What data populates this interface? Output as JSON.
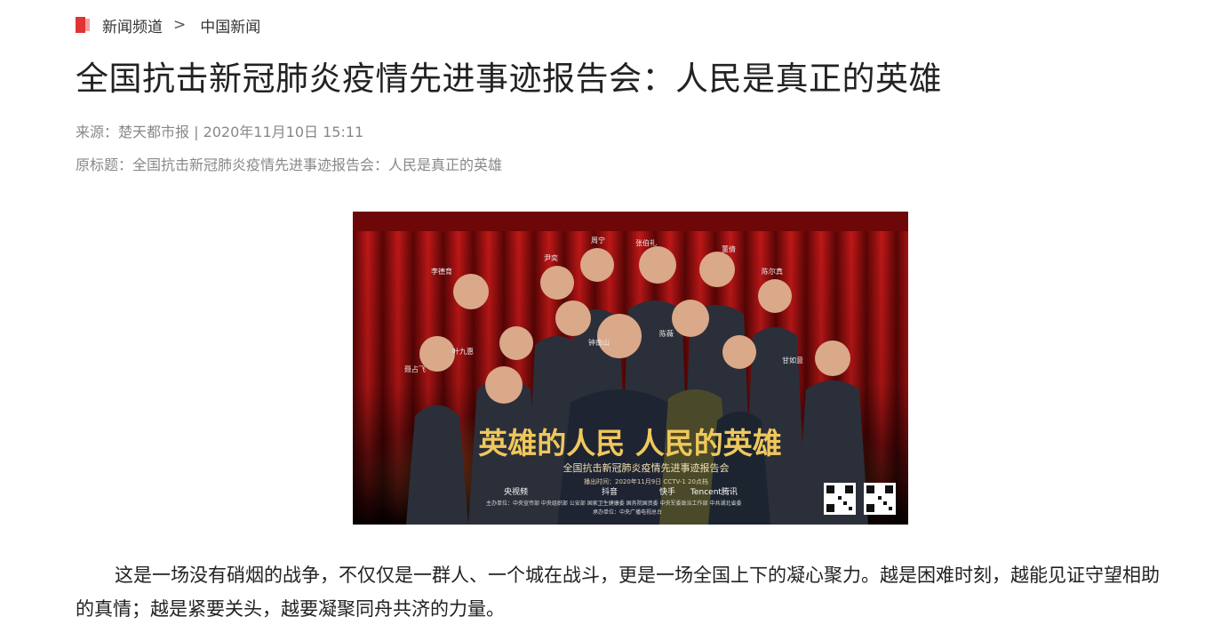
{
  "breadcrumb": {
    "channel": "新闻频道",
    "separator": ">",
    "section": "中国新闻"
  },
  "article": {
    "title": "全国抗击新冠肺炎疫情先进事迹报告会：人民是真正的英雄",
    "meta": "来源：楚天都市报 | 2020年11月10日 15:11",
    "original_title": "原标题：全国抗击新冠肺炎疫情先进事迹报告会：人民是真正的英雄",
    "body": "这是一场没有硝烟的战争，不仅仅是一群人、一个城在战斗，更是一场全国上下的凝心聚力。越是困难时刻，越能见证守望相助的真情；越是紧要关头，越要凝聚同舟共济的力量。"
  },
  "poster": {
    "headline": "英雄的人民  人民的英雄",
    "subtitle": "全国抗击新冠肺炎疫情先进事迹报告会",
    "broadcast": "播出时间：2020年11月9日 CCTV-1 20点档",
    "sponsors": "主办单位：中央宣传部 中央组织部 公安部 国家卫生健康委 国务院国资委 中央军委政治工作部 中共湖北省委",
    "organizer": "承办单位：中央广播电视总台",
    "platforms": [
      "央视频",
      "抖音",
      "快手",
      "Tencent腾讯"
    ],
    "names": [
      "李德育",
      "尹奕",
      "周宁",
      "张伯礼",
      "董倩",
      "陈尔真",
      "叶九惠",
      "钟南山",
      "陈薇",
      "聂占飞",
      "甘如意"
    ],
    "colors": {
      "curtain": "#8e0e0e",
      "gold": "#e8b94a"
    }
  }
}
